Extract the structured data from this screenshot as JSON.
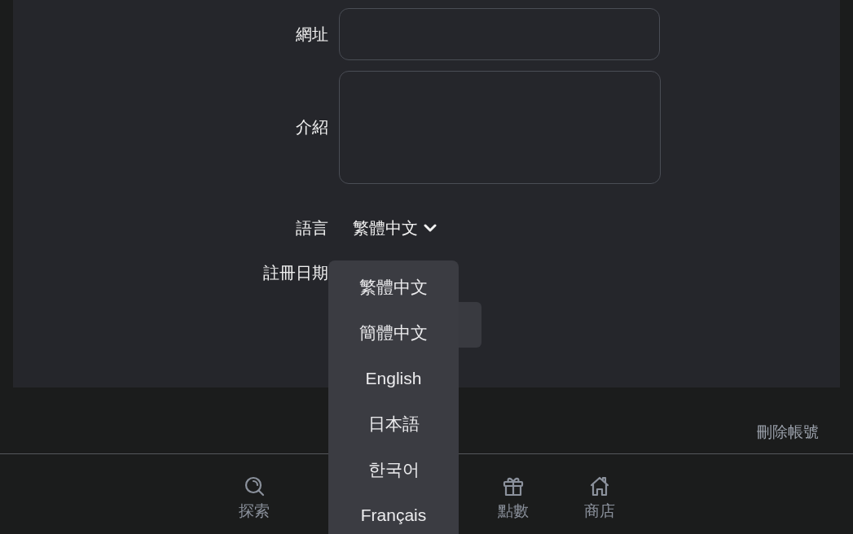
{
  "form": {
    "fields": [
      {
        "kind": "input",
        "label": "網址"
      },
      {
        "kind": "textarea",
        "label": "介紹"
      },
      {
        "kind": "select",
        "label": "語言",
        "value": "繁體中文"
      },
      {
        "kind": "date",
        "label": "註冊日期"
      },
      {
        "kind": "button"
      }
    ]
  },
  "delete_account_link": "刪除帳號",
  "bottom_nav": {
    "items": [
      {
        "kind": "search",
        "label": "探索"
      },
      {
        "kind": "gift",
        "label": "點數"
      },
      {
        "kind": "house",
        "label": "商店"
      }
    ]
  },
  "language_menu": {
    "options": [
      "繁體中文",
      "簡體中文",
      "English",
      "日本語",
      "한국어",
      "Français"
    ]
  }
}
